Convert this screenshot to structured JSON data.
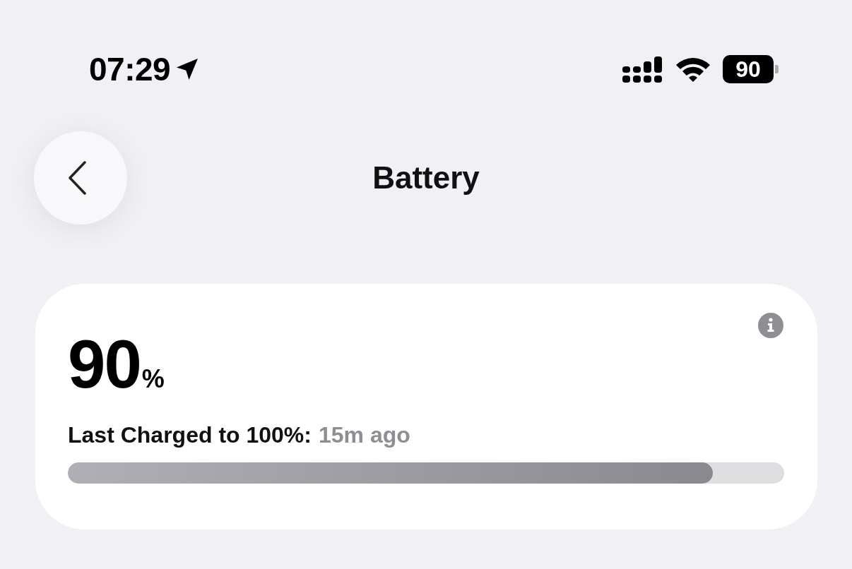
{
  "status_bar": {
    "time": "07:29",
    "battery": "90"
  },
  "nav": {
    "title": "Battery"
  },
  "card": {
    "percent": "90",
    "unit": "%",
    "label": "Last Charged to 100%:",
    "value": "15m ago",
    "level": 0.9
  }
}
